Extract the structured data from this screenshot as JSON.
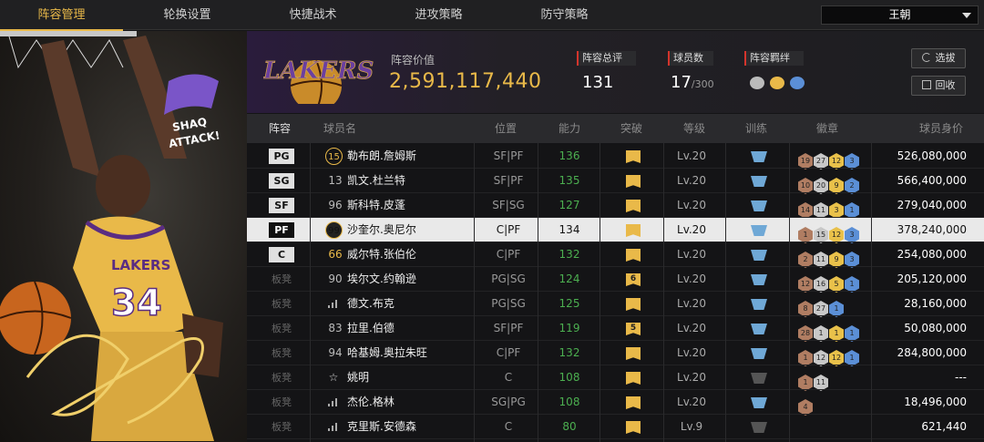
{
  "tabs": [
    {
      "label": "阵容管理",
      "active": true
    },
    {
      "label": "轮换设置",
      "active": false
    },
    {
      "label": "快捷战术",
      "active": false
    },
    {
      "label": "进攻策略",
      "active": false
    },
    {
      "label": "防守策略",
      "active": false
    }
  ],
  "team_select": {
    "value": "王朝"
  },
  "hero": {
    "jersey": "34",
    "shirt_text": "LAKERS",
    "logo_text_1": "SHAQ",
    "logo_text_2": "ATTACK!"
  },
  "team": {
    "logo_text": "LAKERS",
    "value_label": "阵容价值",
    "value": "2,591,117,440",
    "rating_label": "阵容总评",
    "rating": "131",
    "players_label": "球员数",
    "players": "17",
    "players_max": "/300",
    "bond_label": "阵容羁绊",
    "select_btn": "选拔",
    "recycle_btn": "回收"
  },
  "columns": {
    "lineup": "阵容",
    "name": "球员名",
    "position": "位置",
    "ability": "能力",
    "breakthrough": "突破",
    "level": "等级",
    "training": "训练",
    "badges": "徽章",
    "value": "球员身价"
  },
  "colors": {
    "accent": "#e9b949",
    "ability": "#4caf50",
    "bronze": "#b07d62",
    "silver": "#c8c8c8",
    "gold": "#e9c14a",
    "blue": "#5b8fd6"
  },
  "players": [
    {
      "slot": "PG",
      "num": "15",
      "num_style": "circle",
      "name": "勒布朗.詹姆斯",
      "pos": "SF|PF",
      "ability": "136",
      "brk": "",
      "lv": "Lv.20",
      "train": "blue",
      "badges": [
        [
          "19",
          "bronze"
        ],
        [
          "27",
          "silver"
        ],
        [
          "12",
          "gold"
        ],
        [
          "3",
          "blue"
        ]
      ],
      "value": "526,080,000"
    },
    {
      "slot": "SG",
      "num": "13",
      "num_style": "plain",
      "name": "凯文.杜兰特",
      "pos": "SF|PF",
      "ability": "135",
      "brk": "",
      "lv": "Lv.20",
      "train": "blue",
      "badges": [
        [
          "10",
          "bronze"
        ],
        [
          "20",
          "silver"
        ],
        [
          "9",
          "gold"
        ],
        [
          "2",
          "blue"
        ]
      ],
      "value": "566,400,000"
    },
    {
      "slot": "SF",
      "num": "96",
      "num_style": "plain",
      "name": "斯科特.皮蓬",
      "pos": "SF|SG",
      "ability": "127",
      "brk": "",
      "lv": "Lv.20",
      "train": "blue",
      "badges": [
        [
          "14",
          "bronze"
        ],
        [
          "11",
          "silver"
        ],
        [
          "3",
          "gold"
        ],
        [
          "1",
          "blue"
        ]
      ],
      "value": "279,040,000"
    },
    {
      "slot": "PF",
      "num": "99",
      "num_style": "circle-dark",
      "name": "沙奎尔.奥尼尔",
      "pos": "C|PF",
      "ability": "134",
      "brk": "",
      "lv": "Lv.20",
      "train": "blue",
      "badges": [
        [
          "1",
          "bronze"
        ],
        [
          "15",
          "silver"
        ],
        [
          "12",
          "gold"
        ],
        [
          "3",
          "blue"
        ]
      ],
      "value": "378,240,000",
      "selected": true
    },
    {
      "slot": "C",
      "num": "66",
      "num_style": "gold",
      "name": "威尔特.张伯伦",
      "pos": "C|PF",
      "ability": "132",
      "brk": "",
      "lv": "Lv.20",
      "train": "blue",
      "badges": [
        [
          "2",
          "bronze"
        ],
        [
          "11",
          "silver"
        ],
        [
          "9",
          "gold"
        ],
        [
          "3",
          "blue"
        ]
      ],
      "value": "254,080,000"
    },
    {
      "slot": "板凳",
      "num": "90",
      "num_style": "plain",
      "name": "埃尔文.约翰逊",
      "pos": "PG|SG",
      "ability": "124",
      "brk": "6",
      "lv": "Lv.20",
      "train": "blue",
      "badges": [
        [
          "12",
          "bronze"
        ],
        [
          "16",
          "silver"
        ],
        [
          "5",
          "gold"
        ],
        [
          "1",
          "blue"
        ]
      ],
      "value": "205,120,000"
    },
    {
      "slot": "板凳",
      "num": "",
      "num_style": "bars",
      "name": "德文.布克",
      "pos": "PG|SG",
      "ability": "125",
      "brk": "",
      "lv": "Lv.20",
      "train": "blue",
      "badges": [
        [
          "8",
          "bronze"
        ],
        [
          "27",
          "silver"
        ],
        [
          "1",
          "blue"
        ]
      ],
      "value": "28,160,000"
    },
    {
      "slot": "板凳",
      "num": "83",
      "num_style": "plain",
      "name": "拉里.伯德",
      "pos": "SF|PF",
      "ability": "119",
      "brk": "5",
      "lv": "Lv.20",
      "train": "blue",
      "badges": [
        [
          "28",
          "bronze"
        ],
        [
          "1",
          "silver"
        ],
        [
          "1",
          "gold"
        ],
        [
          "1",
          "blue"
        ]
      ],
      "value": "50,080,000"
    },
    {
      "slot": "板凳",
      "num": "94",
      "num_style": "plain",
      "name": "哈基姆.奥拉朱旺",
      "pos": "C|PF",
      "ability": "132",
      "brk": "",
      "lv": "Lv.20",
      "train": "blue",
      "badges": [
        [
          "1",
          "bronze"
        ],
        [
          "12",
          "silver"
        ],
        [
          "12",
          "gold"
        ],
        [
          "1",
          "blue"
        ]
      ],
      "value": "284,800,000"
    },
    {
      "slot": "板凳",
      "num": "",
      "num_style": "star",
      "name": "姚明",
      "pos": "C",
      "ability": "108",
      "brk": "",
      "lv": "Lv.20",
      "train": "grey",
      "badges": [
        [
          "1",
          "bronze"
        ],
        [
          "11",
          "silver"
        ]
      ],
      "value": "---"
    },
    {
      "slot": "板凳",
      "num": "",
      "num_style": "bars",
      "name": "杰伦.格林",
      "pos": "SG|PG",
      "ability": "108",
      "brk": "",
      "lv": "Lv.20",
      "train": "blue",
      "badges": [
        [
          "4",
          "bronze"
        ]
      ],
      "value": "18,496,000"
    },
    {
      "slot": "板凳",
      "num": "",
      "num_style": "bars",
      "name": "克里斯.安德森",
      "pos": "C",
      "ability": "80",
      "brk": "",
      "lv": "Lv.9",
      "train": "grey",
      "badges": [],
      "value": "621,440"
    }
  ]
}
